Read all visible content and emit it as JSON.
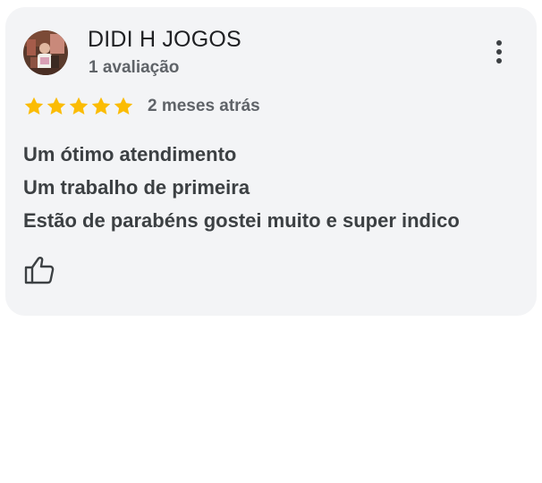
{
  "review": {
    "reviewer_name": "DIDI H JOGOS",
    "review_count": "1 avaliação",
    "rating": 5,
    "rating_max": 5,
    "date": "2 meses atrás",
    "text_lines": [
      "Um ótimo atendimento",
      "Um trabalho de primeira",
      "Estão de parabéns gostei muito e super indico"
    ]
  },
  "colors": {
    "card_background": "#f3f4f6",
    "star": "#fbbc04",
    "text_primary": "#202124",
    "text_secondary": "#5f6368",
    "text_body": "#3c4043"
  },
  "icons": {
    "avatar": "profile-photo",
    "more": "more-vertical-icon",
    "star": "star-icon",
    "like": "thumbs-up-icon"
  }
}
